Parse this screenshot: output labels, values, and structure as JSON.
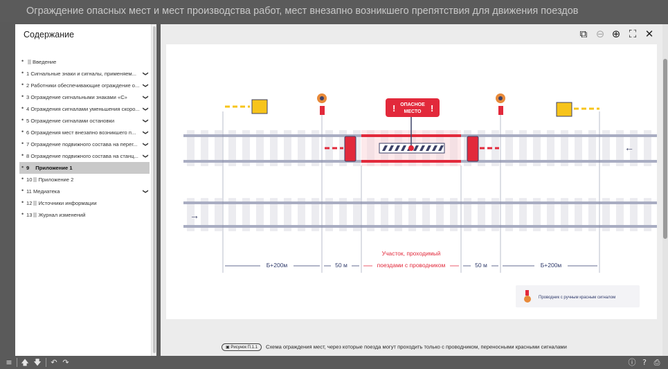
{
  "window": {
    "title": "Ограждение опасных мест и мест производства работ, мест внезапно возникшего препятствия для движения поездов"
  },
  "sidebar": {
    "title": "Содержание",
    "items": [
      {
        "label": "Введение",
        "doc": true,
        "expandable": false,
        "active": false
      },
      {
        "label": "1 Сигнальные знаки и сигналы, применяем...",
        "doc": false,
        "expandable": true,
        "active": false
      },
      {
        "label": "2 Работники обеспечивающие ограждение о...",
        "doc": false,
        "expandable": true,
        "active": false
      },
      {
        "label": "3 Ограждение сигнальными знаками «С»",
        "doc": false,
        "expandable": true,
        "active": false
      },
      {
        "label": "4 Ограждения сигналами уменьшения скоро...",
        "doc": false,
        "expandable": true,
        "active": false
      },
      {
        "label": "5 Ограждение сигналами остановки",
        "doc": false,
        "expandable": true,
        "active": false
      },
      {
        "label": "6 Ограждения мест внезапно возникшего п...",
        "doc": false,
        "expandable": true,
        "active": false
      },
      {
        "label": "7 Ограждение подвижного состава на перег...",
        "doc": false,
        "expandable": true,
        "active": false
      },
      {
        "label": "8 Ограждение подвижного состава на станц...",
        "doc": false,
        "expandable": true,
        "active": false
      },
      {
        "label": "Приложение 1",
        "num": "9",
        "doc": true,
        "expandable": false,
        "active": true
      },
      {
        "label": "Приложение 2",
        "num": "10",
        "doc": true,
        "expandable": false,
        "active": false
      },
      {
        "label": "11 Медиатека",
        "doc": false,
        "expandable": true,
        "active": false
      },
      {
        "label": "Источники информации",
        "num": "12",
        "doc": true,
        "expandable": false,
        "active": false
      },
      {
        "label": "Журнал изменений",
        "num": "13",
        "doc": true,
        "expandable": false,
        "active": false
      }
    ]
  },
  "toolbar": {
    "icons": [
      "copy-icon",
      "zoom-out-icon",
      "zoom-in-icon",
      "fullscreen-icon",
      "close-icon"
    ],
    "glyphs": [
      "⧉",
      "⊖",
      "⊕",
      "⛶",
      "✕"
    ]
  },
  "figure": {
    "danger_label_line1": "ОПАСНОЕ",
    "danger_label_line2": "МЕСТО",
    "dim_left": "Б+200м",
    "dim_50_left": "50 м",
    "section_line1": "Участок, проходимый",
    "section_line2": "поездами с проводником",
    "dim_50_right": "50 м",
    "dim_right": "Б+200м",
    "legend": "Проводник с ручным красным сигналом",
    "colors": {
      "red": "#e2293b",
      "yellow": "#f7c41b",
      "rail": "#a9adc2",
      "tie": "#ececf0",
      "dark": "#3d4268",
      "dim": "#2f3a6b"
    }
  },
  "caption": {
    "badge": "Рисунок П.1.1",
    "text": "Схема ограждения мест, через которые поезда могут проходить только с проводником, переносными красными сигналами"
  },
  "bottombar": {
    "left": [
      "≡",
      "🡅",
      "🡇",
      "↶",
      "↷"
    ],
    "right": [
      "ⓘ",
      "?",
      "⎙"
    ]
  }
}
